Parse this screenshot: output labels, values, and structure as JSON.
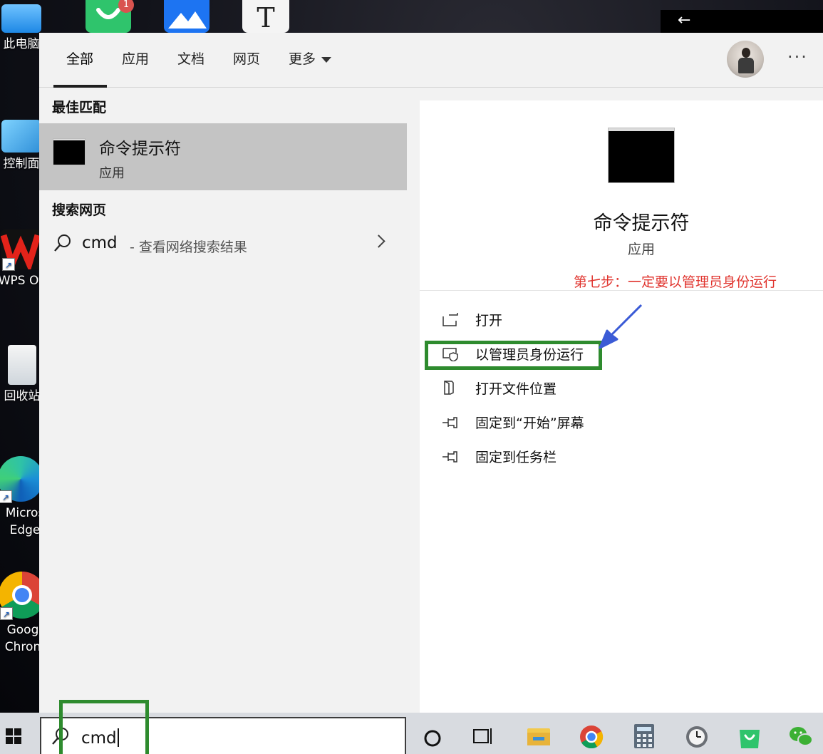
{
  "desktop": {
    "icons": [
      {
        "label": "此电脑"
      },
      {
        "label": "控制面"
      },
      {
        "label": "WPS Of"
      },
      {
        "label": "回收站"
      },
      {
        "label": "Micros Edge"
      },
      {
        "label": "Goog Chron"
      }
    ],
    "badge_count": "1",
    "top_app_letter": "T",
    "back_glyph": "←"
  },
  "tabs": [
    {
      "label": "全部",
      "active": true
    },
    {
      "label": "应用"
    },
    {
      "label": "文档"
    },
    {
      "label": "网页"
    },
    {
      "label": "更多"
    }
  ],
  "more_dots": "···",
  "best_match": {
    "heading": "最佳匹配",
    "name": "命令提示符",
    "type": "应用"
  },
  "web_search": {
    "heading": "搜索网页",
    "query": "cmd",
    "hint": "- 查看网络搜索结果"
  },
  "detail": {
    "name": "命令提示符",
    "type": "应用",
    "annotation": "第七步：一定要以管理员身份运行",
    "actions": [
      {
        "label": "打开",
        "icon": "open-icon"
      },
      {
        "label": "以管理员身份运行",
        "icon": "shield-icon"
      },
      {
        "label": "打开文件位置",
        "icon": "file-location-icon"
      },
      {
        "label": "固定到“开始”屏幕",
        "icon": "pin-icon"
      },
      {
        "label": "固定到任务栏",
        "icon": "pin-icon"
      }
    ]
  },
  "taskbar": {
    "search_value": "cmd",
    "apps": [
      "cortana-icon",
      "task-view-icon",
      "file-explorer-icon",
      "chrome-icon",
      "calculator-icon",
      "clock-icon",
      "store-icon",
      "wechat-icon"
    ]
  },
  "colors": {
    "annotation": "#e0332d",
    "highlight_box": "#2e8b2e",
    "arrow": "#3b5bd6"
  }
}
